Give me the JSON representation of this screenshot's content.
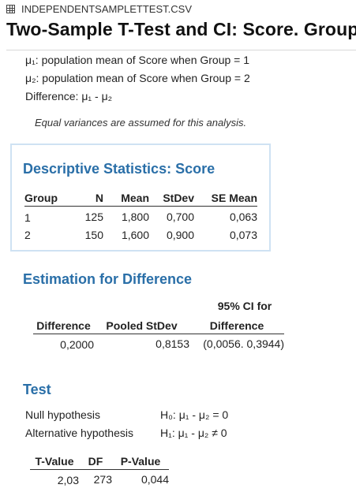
{
  "header": {
    "icon": "table-grid-icon",
    "filename": "INDEPENDENTSAMPLETTEST.CSV"
  },
  "title": "Two-Sample T-Test and CI: Score. Group",
  "definitions": [
    "μ₁: population mean of Score when Group = 1",
    "μ₂: population mean of Score when Group = 2",
    "Difference: μ₁ - μ₂"
  ],
  "note": "Equal variances are assumed for this analysis.",
  "descriptive": {
    "title": "Descriptive Statistics: Score",
    "columns": [
      "Group",
      "N",
      "Mean",
      "StDev",
      "SE Mean"
    ],
    "rows": [
      [
        "1",
        "125",
        "1,800",
        "0,700",
        "0,063"
      ],
      [
        "2",
        "150",
        "1,600",
        "0,900",
        "0,073"
      ]
    ]
  },
  "estimation": {
    "title": "Estimation for Difference",
    "columns": [
      "Difference",
      "Pooled StDev",
      "95% CI for",
      "Difference"
    ],
    "row": [
      "0,2000",
      "0,8153",
      "(0,0056. 0,3944)"
    ]
  },
  "test": {
    "title": "Test",
    "null_label": "Null hypothesis",
    "null_value": "H₀: μ₁ - μ₂ = 0",
    "alt_label": "Alternative hypothesis",
    "alt_value": "H₁: μ₁ - μ₂ ≠ 0",
    "columns": [
      "T-Value",
      "DF",
      "P-Value"
    ],
    "row": [
      "2,03",
      "273",
      "0,044"
    ]
  }
}
